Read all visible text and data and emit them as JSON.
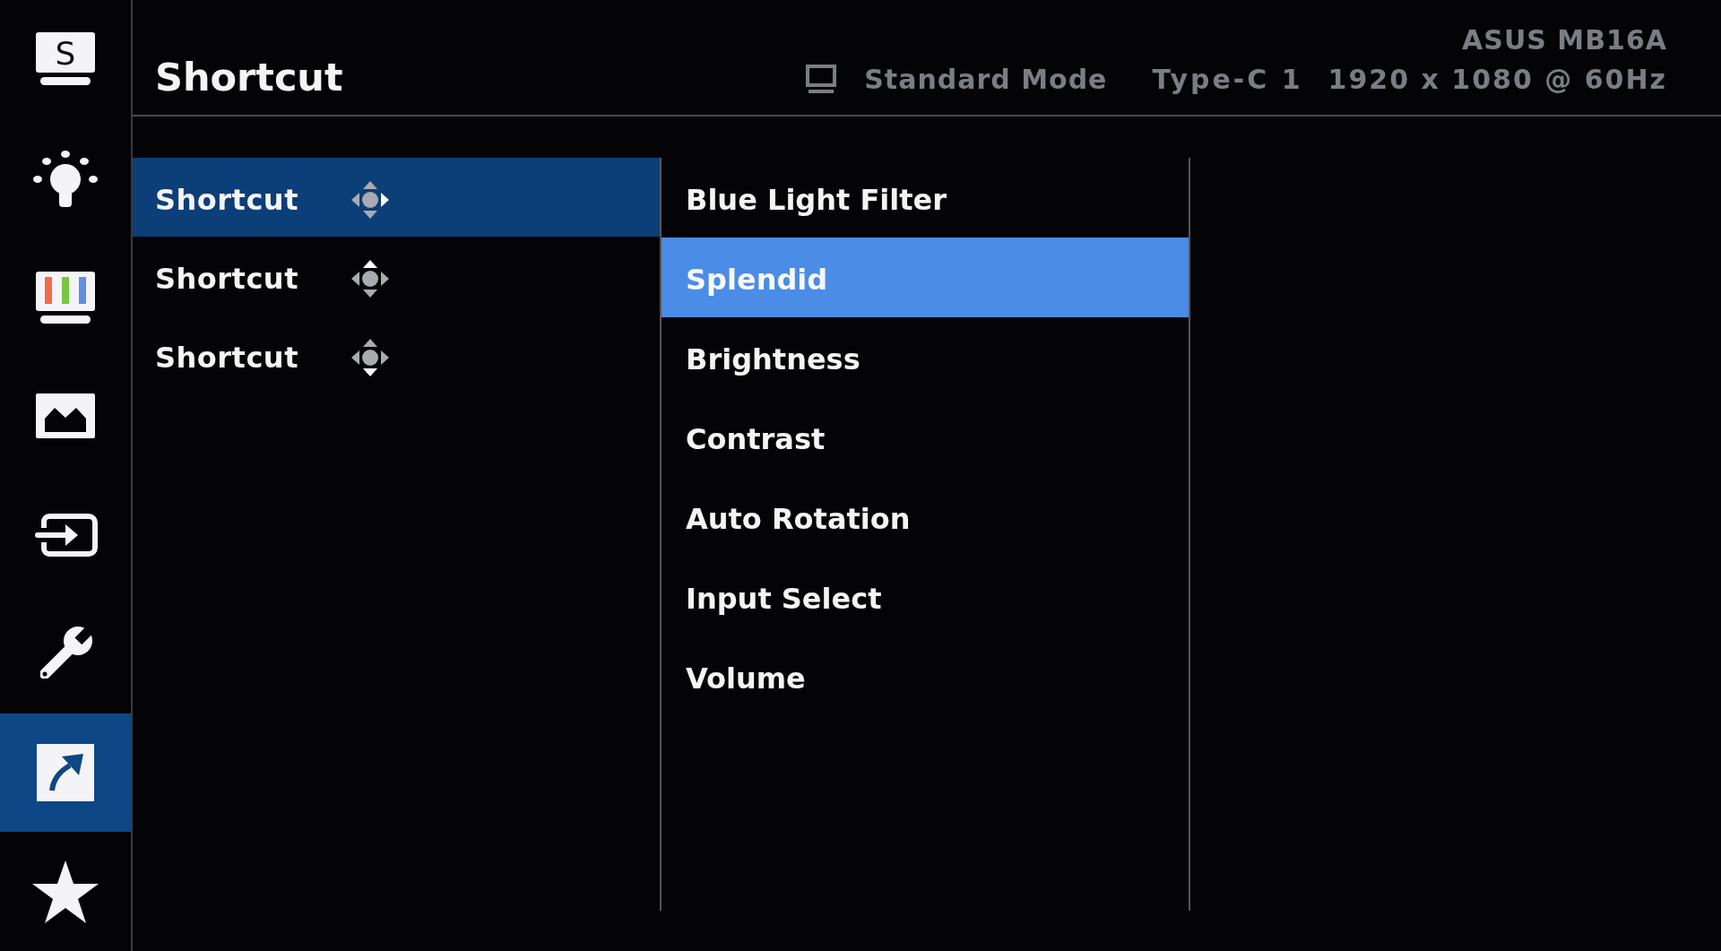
{
  "sidebar": {
    "items": [
      {
        "letter": "S",
        "selected": false
      },
      {
        "selected": false
      },
      {
        "selected": false
      },
      {
        "selected": false
      },
      {
        "selected": false
      },
      {
        "selected": false
      },
      {
        "selected": true
      },
      {
        "selected": false
      }
    ]
  },
  "header": {
    "title": "Shortcut",
    "model": "ASUS MB16A",
    "mode": "Standard Mode",
    "input": "Type-C 1",
    "resolution": "1920 x 1080 @ 60Hz"
  },
  "shortcut_slots": [
    {
      "label": "Shortcut",
      "selected": true,
      "arrows": {
        "up": false,
        "down": false,
        "left": false,
        "right": true
      }
    },
    {
      "label": "Shortcut",
      "selected": false,
      "arrows": {
        "up": true,
        "down": false,
        "left": false,
        "right": false
      }
    },
    {
      "label": "Shortcut",
      "selected": false,
      "arrows": {
        "up": false,
        "down": true,
        "left": false,
        "right": false
      }
    }
  ],
  "functions": [
    {
      "label": "Blue Light Filter",
      "selected": false
    },
    {
      "label": "Splendid",
      "selected": true
    },
    {
      "label": "Brightness",
      "selected": false
    },
    {
      "label": "Contrast",
      "selected": false
    },
    {
      "label": "Auto Rotation",
      "selected": false
    },
    {
      "label": "Input Select",
      "selected": false
    },
    {
      "label": "Volume",
      "selected": false
    }
  ]
}
